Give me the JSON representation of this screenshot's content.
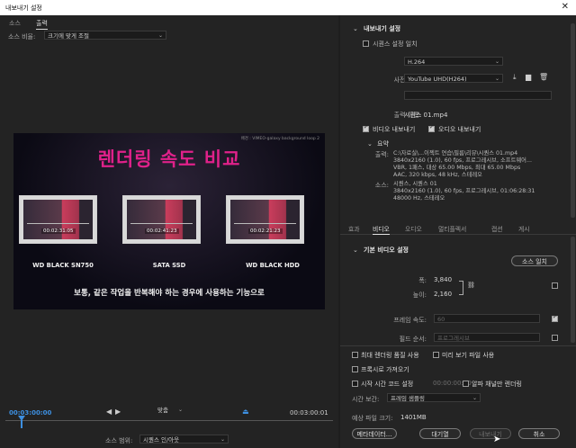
{
  "window": {
    "title": "내보내기 설정",
    "close": "✕"
  },
  "left_tabs": [
    "소스",
    "출력"
  ],
  "source": {
    "scale_label": "소스 비율:",
    "scale_value": "크기에 맞게 조절"
  },
  "preview": {
    "watermark": "배경 : VIMEO-galaxy background loop 2",
    "title": "렌더링 속도 비교",
    "thumbs": [
      {
        "time": "00:02:31:05",
        "label": "WD BLACK SN750"
      },
      {
        "time": "00:02:41:23",
        "label": "SATA SSD"
      },
      {
        "time": "00:02:21:23",
        "label": "WD BLACK HDD"
      }
    ],
    "subtitle": "보통, 같은 작업을 반복해야 하는 경우에 사용하는 기능으로"
  },
  "timeline": {
    "start_tc": "00:03:00:00",
    "end_tc": "00:03:00:01",
    "fit": "맞춤",
    "range_label": "소스 범위:",
    "range_value": "시퀀스 인/아웃"
  },
  "export": {
    "section": "내보내기 설정",
    "match_seq": "시퀀스 설정 일치",
    "format_label": "형식:",
    "format_value": "H.264",
    "preset_label": "사전 설정:",
    "preset_value": "YouTube UHD(H264)",
    "comment_label": "설명:",
    "output_label": "출력 이름:",
    "output_value": "시퀀스 01.mp4",
    "export_video": "비디오 내보내기",
    "export_audio": "오디오 내보내기",
    "summary_hdr": "요약",
    "out_label": "출력:",
    "out_lines": [
      "C:\\자료실\\...이젝트 연습\\필름\\리뷰\\시퀀스 01.mp4",
      "3840x2160 (1.0), 60 fps, 프로그레시브, 소프트웨어...",
      "VBR, 1패스, 대상 65.00 Mbps, 최대 65.00 Mbps",
      "AAC, 320 kbps, 48 kHz, 스테레오"
    ],
    "src_label": "소스:",
    "src_lines": [
      "시퀀스, 시퀀스 01",
      "3840x2160 (1.0), 60 fps, 프로그레시브, 01:06:28:31",
      "48000 Hz, 스테레오"
    ]
  },
  "right_tabs": [
    "효과",
    "비디오",
    "오디오",
    "멀티플렉서",
    "캡션",
    "게시"
  ],
  "video": {
    "section": "기본 비디오 설정",
    "match_source": "소스 일치",
    "width_label": "폭:",
    "width_value": "3,840",
    "height_label": "높이:",
    "height_value": "2,160",
    "fps_label": "프레임 속도:",
    "fps_value": "60",
    "field_label": "필드 순서:",
    "field_value": "프로그레시브"
  },
  "bottom": {
    "max_render": "최대 렌더링 품질 사용",
    "preview_use": "미리 보기 파일 사용",
    "proxy": "프록시로 가져오기",
    "start_tc": "시작 시간 코드 설정",
    "start_tc_value": "00:00:00:00",
    "alpha_only": "알파 채널만 렌더링",
    "interp_label": "시간 보간:",
    "interp_value": "프레임 샘플링",
    "filesize_label": "예상 파일 크기:",
    "filesize_value": "1401MB",
    "metadata_btn": "메타데이터...",
    "queue_btn": "대기열",
    "export_btn": "내보내기",
    "cancel_btn": "취소"
  }
}
